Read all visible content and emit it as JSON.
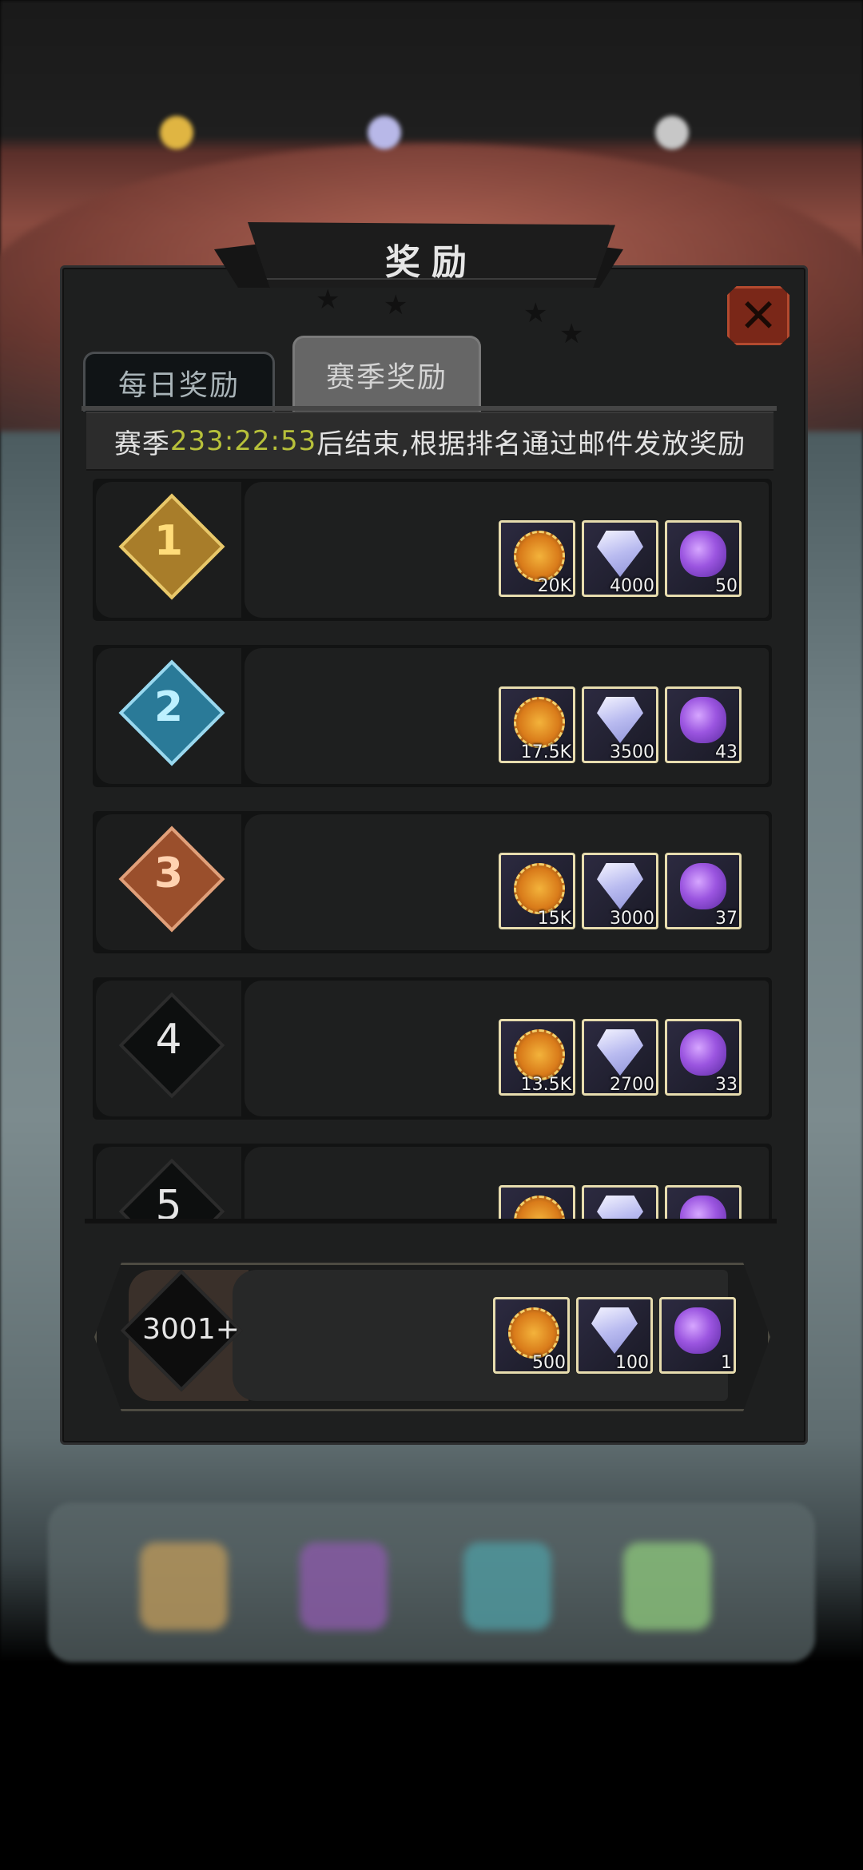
{
  "panel": {
    "title": "奖励",
    "tabs": [
      {
        "label": "每日奖励",
        "active": false
      },
      {
        "label": "赛季奖励",
        "active": true
      }
    ],
    "info": {
      "prefix": "赛季",
      "countdown": "233:22:53",
      "suffix": " 后结束,根据排名通过邮件发放奖励"
    }
  },
  "ranks": [
    {
      "rank": "1",
      "style": "gold",
      "rewards": [
        {
          "icon": "coin-icon",
          "qty": "20K"
        },
        {
          "icon": "gem-icon",
          "qty": "4000"
        },
        {
          "icon": "orb-icon",
          "qty": "50"
        }
      ]
    },
    {
      "rank": "2",
      "style": "silver",
      "rewards": [
        {
          "icon": "coin-icon",
          "qty": "17.5K"
        },
        {
          "icon": "gem-icon",
          "qty": "3500"
        },
        {
          "icon": "orb-icon",
          "qty": "43"
        }
      ]
    },
    {
      "rank": "3",
      "style": "bronze",
      "rewards": [
        {
          "icon": "coin-icon",
          "qty": "15K"
        },
        {
          "icon": "gem-icon",
          "qty": "3000"
        },
        {
          "icon": "orb-icon",
          "qty": "37"
        }
      ]
    },
    {
      "rank": "4",
      "style": "plain",
      "rewards": [
        {
          "icon": "coin-icon",
          "qty": "13.5K"
        },
        {
          "icon": "gem-icon",
          "qty": "2700"
        },
        {
          "icon": "orb-icon",
          "qty": "33"
        }
      ]
    },
    {
      "rank": "5",
      "style": "plain",
      "rewards": [
        {
          "icon": "coin-icon",
          "qty": ""
        },
        {
          "icon": "gem-icon",
          "qty": ""
        },
        {
          "icon": "orb-icon",
          "qty": ""
        }
      ]
    }
  ],
  "my_rank": {
    "rank": "3001+",
    "rewards": [
      {
        "icon": "coin-icon",
        "qty": "500"
      },
      {
        "icon": "gem-icon",
        "qty": "100"
      },
      {
        "icon": "orb-icon",
        "qty": "1"
      }
    ]
  },
  "colors": {
    "countdown": "#b7c03a",
    "gold": "#d4a63a",
    "silver": "#4fb3d6",
    "bronze": "#c06a3f"
  }
}
